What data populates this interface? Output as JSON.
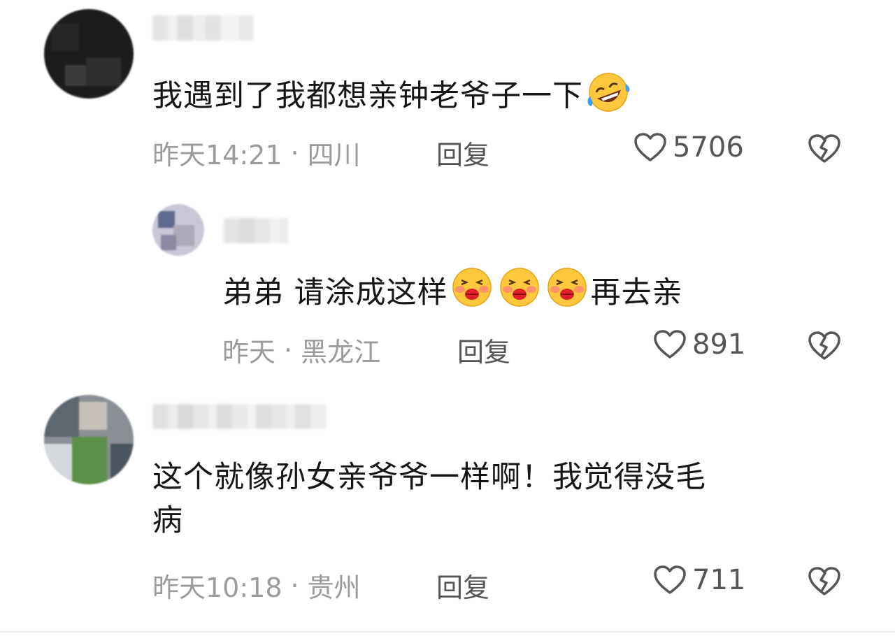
{
  "comments": [
    {
      "text": "我遇到了我都想亲钟老爷子一下",
      "emoji": "rolling-on-floor-laughing-emoji",
      "time": "昨天14:21",
      "location": "四川",
      "reply_label": "回复",
      "likes": "5706"
    },
    {
      "text_before": "弟弟 请涂成这样",
      "text_after": "再去亲",
      "emoji": "kissing-lips-emoji",
      "time": "昨天",
      "location": "黑龙江",
      "reply_label": "回复",
      "likes": "891"
    },
    {
      "text_line1": "这个就像孙女亲爷爷一样啊！我觉得没毛",
      "text_line2": "病",
      "time": "昨天10:18",
      "location": "贵州",
      "reply_label": "回复",
      "likes": "711"
    }
  ],
  "separator": "·",
  "colors": {
    "meta": "#9b9b9b",
    "text": "#161616",
    "action": "#555555"
  }
}
